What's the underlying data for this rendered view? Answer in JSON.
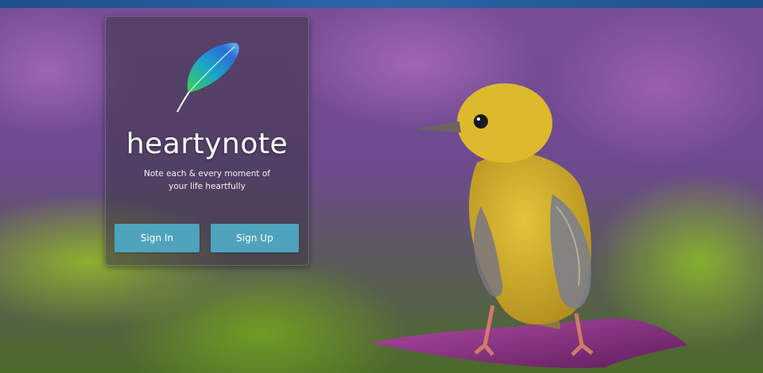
{
  "app": {
    "name": "heartynote",
    "tagline_line1": "Note each & every moment of",
    "tagline_line2": "your life heartfully"
  },
  "actions": {
    "sign_in_label": "Sign In",
    "sign_up_label": "Sign Up"
  },
  "colors": {
    "top_bar": "#2a67a8",
    "button": "#4fa3bd",
    "card_overlay": "rgba(60,55,70,0.55)"
  },
  "icons": {
    "logo": "feather-icon"
  }
}
